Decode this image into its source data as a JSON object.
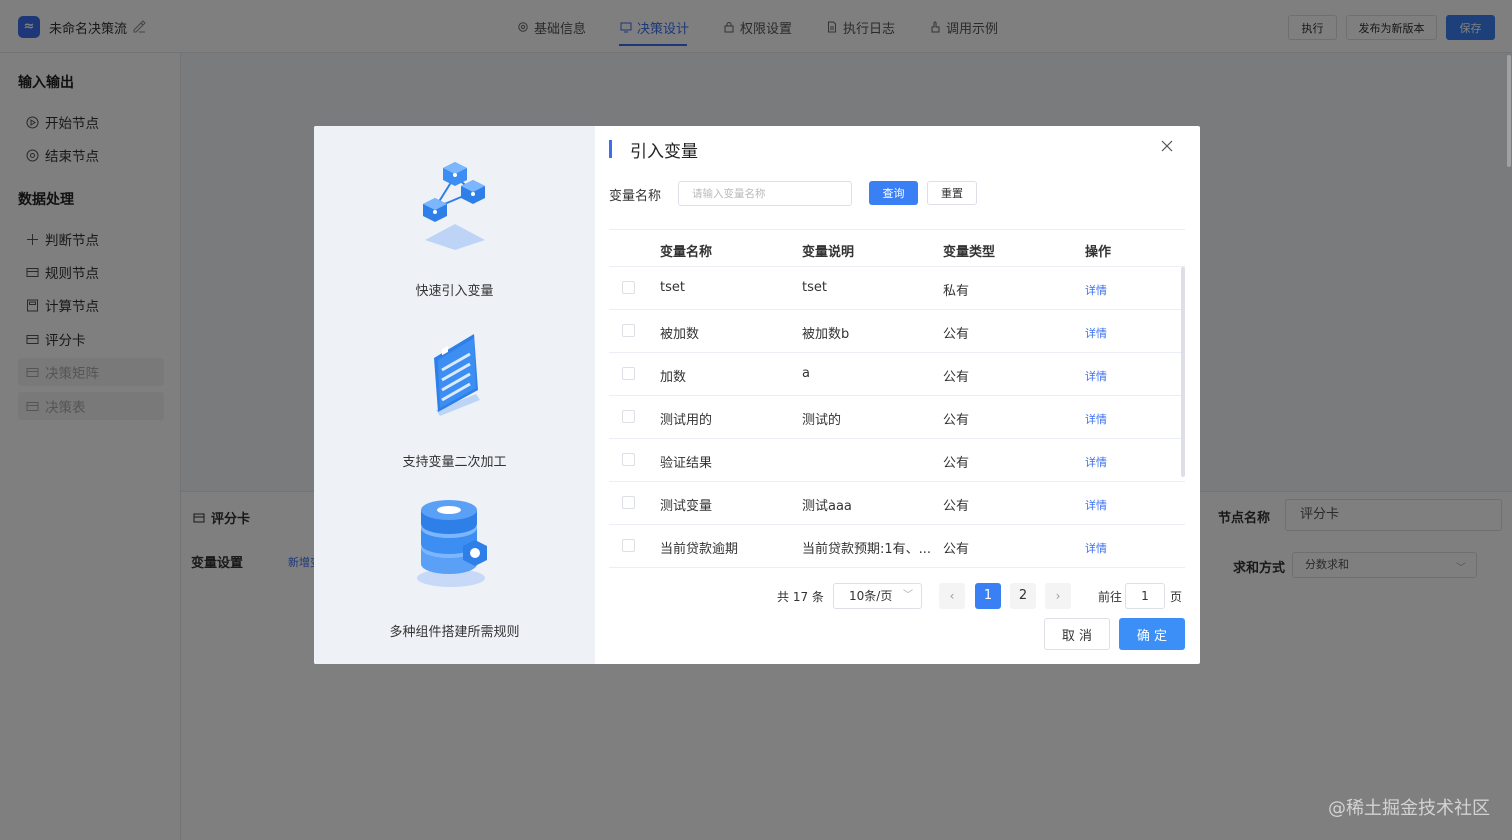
{
  "header": {
    "logo": "≈",
    "flow_name": "未命名决策流",
    "tabs": [
      {
        "label": "基础信息",
        "icon": "gear-icon"
      },
      {
        "label": "决策设计",
        "icon": "monitor-icon"
      },
      {
        "label": "权限设置",
        "icon": "lock-icon"
      },
      {
        "label": "执行日志",
        "icon": "document-icon"
      },
      {
        "label": "调用示例",
        "icon": "hand-icon"
      }
    ],
    "active_tab": "决策设计",
    "run_label": "执行",
    "publish_label": "发布为新版本",
    "save_label": "保存"
  },
  "sidebar": {
    "section1": "输入输出",
    "io_items": [
      {
        "label": "开始节点",
        "icon": "play-circle-icon"
      },
      {
        "label": "结束节点",
        "icon": "stop-circle-icon"
      }
    ],
    "section2": "数据处理",
    "data_items": [
      {
        "label": "判断节点",
        "icon": "branch-icon",
        "disabled": false
      },
      {
        "label": "规则节点",
        "icon": "card-icon",
        "disabled": false
      },
      {
        "label": "计算节点",
        "icon": "calculator-icon",
        "disabled": false
      },
      {
        "label": "评分卡",
        "icon": "card-icon",
        "disabled": false
      },
      {
        "label": "决策矩阵",
        "icon": "card-icon",
        "disabled": true
      },
      {
        "label": "决策表",
        "icon": "card-icon",
        "disabled": true
      }
    ]
  },
  "bottom_panel": {
    "title": "评分卡",
    "var_setting_label": "变量设置",
    "add_link": "新增变",
    "node_name_label": "节点名称",
    "node_name_value": "评分卡",
    "sum_method_label": "求和方式",
    "sum_method_value": "分数求和"
  },
  "dialog": {
    "title": "引入变量",
    "features": [
      {
        "label": "快速引入变量",
        "icon": "cubes-network-icon"
      },
      {
        "label": "支持变量二次加工",
        "icon": "checklist-icon"
      },
      {
        "label": "多种组件搭建所需规则",
        "icon": "database-gear-icon"
      }
    ],
    "search": {
      "label": "变量名称",
      "placeholder": "请输入变量名称",
      "value": "",
      "query_label": "查询",
      "reset_label": "重置"
    },
    "table": {
      "columns": [
        "变量名称",
        "变量说明",
        "变量类型",
        "操作"
      ],
      "rows": [
        {
          "name": "tset",
          "desc": "tset",
          "type": "私有",
          "action": "详情"
        },
        {
          "name": "被加数",
          "desc": "被加数b",
          "type": "公有",
          "action": "详情"
        },
        {
          "name": "加数",
          "desc": "a",
          "type": "公有",
          "action": "详情"
        },
        {
          "name": "测试用的",
          "desc": "测试的",
          "type": "公有",
          "action": "详情"
        },
        {
          "name": "验证结果",
          "desc": "",
          "type": "公有",
          "action": "详情"
        },
        {
          "name": "测试变量",
          "desc": "测试aaa",
          "type": "公有",
          "action": "详情"
        },
        {
          "name": "当前贷款逾期",
          "desc": "当前贷款预期:1有、...",
          "type": "公有",
          "action": "详情"
        }
      ]
    },
    "pager": {
      "total": "共 17 条",
      "page_size": "10条/页",
      "prev": "‹",
      "pages": [
        "1",
        "2"
      ],
      "current": "1",
      "next": "›",
      "goto_label": "前往",
      "goto_value": "1",
      "goto_unit": "页"
    },
    "cancel_label": "取 消",
    "ok_label": "确 定"
  },
  "watermark": "@稀土掘金技术社区",
  "colors": {
    "primary": "#3b7ff5",
    "overlay": "rgba(0,0,0,0.5)",
    "dialog_left_bg": "#eef2f7"
  }
}
